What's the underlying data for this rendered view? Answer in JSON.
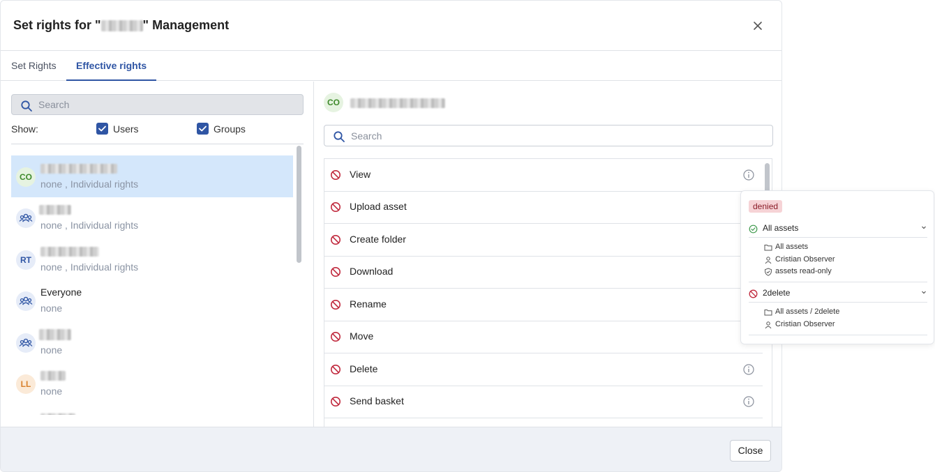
{
  "dialog": {
    "title_prefix": "Set rights for \"",
    "title_suffix": "\" Management",
    "tabs": [
      {
        "label": "Set Rights",
        "active": false
      },
      {
        "label": "Effective rights",
        "active": true
      }
    ]
  },
  "left": {
    "search_placeholder": "Search",
    "show_label": "Show:",
    "filters": {
      "users_label": "Users",
      "groups_label": "Groups",
      "users_checked": true,
      "groups_checked": true
    },
    "items": [
      {
        "avatar": "CO",
        "sub": "none , Individual rights"
      },
      {
        "avatar": "",
        "sub": "none , Individual rights"
      },
      {
        "avatar": "RT",
        "sub": "none , Individual rights"
      },
      {
        "avatar": "",
        "name": "Everyone",
        "sub": "none"
      },
      {
        "avatar": "",
        "sub": "none"
      },
      {
        "avatar": "LL",
        "sub": "none"
      }
    ]
  },
  "right": {
    "avatar": "CO",
    "search_placeholder": "Search",
    "rights": [
      {
        "label": "View"
      },
      {
        "label": "Upload asset"
      },
      {
        "label": "Create folder"
      },
      {
        "label": "Download"
      },
      {
        "label": "Rename"
      },
      {
        "label": "Move"
      },
      {
        "label": "Delete"
      },
      {
        "label": "Send basket"
      }
    ]
  },
  "popover": {
    "status": "denied",
    "groups": [
      {
        "label": "All assets",
        "details": [
          "All assets",
          "Cristian Observer",
          "assets read-only"
        ]
      },
      {
        "label": "2delete",
        "details": [
          "All assets / 2delete",
          "Cristian Observer"
        ]
      }
    ]
  },
  "footer": {
    "close_label": "Close"
  },
  "colors": {
    "accent": "#2f55a4",
    "deny": "#c0283c",
    "allow": "#3f9a4d",
    "selected_row": "#d4e7fb",
    "denied_badge": "#f6d3d6"
  }
}
